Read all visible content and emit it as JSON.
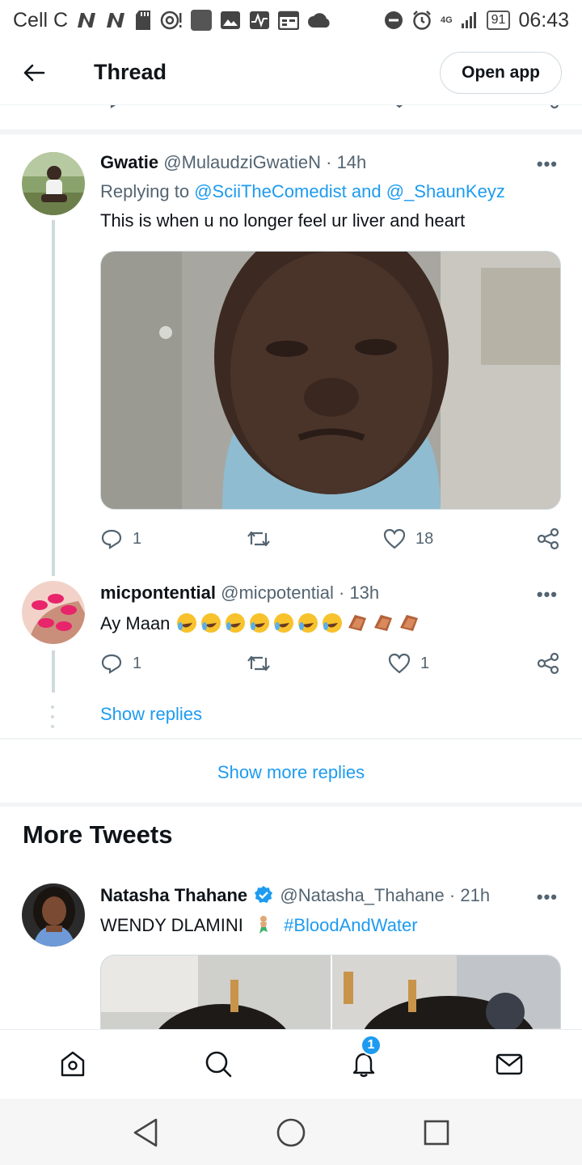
{
  "status_bar": {
    "carrier": "Cell C",
    "network": "4G",
    "battery": "91",
    "time": "06:43"
  },
  "header": {
    "title": "Thread",
    "open_app_label": "Open app"
  },
  "tweets": [
    {
      "name": "Gwatie",
      "handle": "@MulaudziGwatieN",
      "time": "· 14h",
      "replying_prefix": "Replying to ",
      "replying_to": "@SciiTheComedist and @_ShaunKeyz",
      "text": "This is when u no longer feel ur liver and heart",
      "replies": "1",
      "retweets": "",
      "likes": "18"
    },
    {
      "name": "micpontential",
      "handle": "@micpotential",
      "time": "· 13h",
      "text": "Ay Maan",
      "replies": "1",
      "retweets": "",
      "likes": "1",
      "show_replies_label": "Show replies"
    }
  ],
  "show_more_replies_label": "Show more replies",
  "more_tweets": {
    "title": "More Tweets",
    "tweet": {
      "name": "Natasha Thahane",
      "handle": "@Natasha_Thahane",
      "time": "· 21h",
      "text": "WENDY DLAMINI",
      "hashtag": "#BloodAndWater"
    }
  },
  "bottom_nav": {
    "notifications_badge": "1"
  },
  "colors": {
    "link": "#1d9bf0",
    "muted": "#536471",
    "text": "#0f1419",
    "divider": "#f2f4f5"
  }
}
